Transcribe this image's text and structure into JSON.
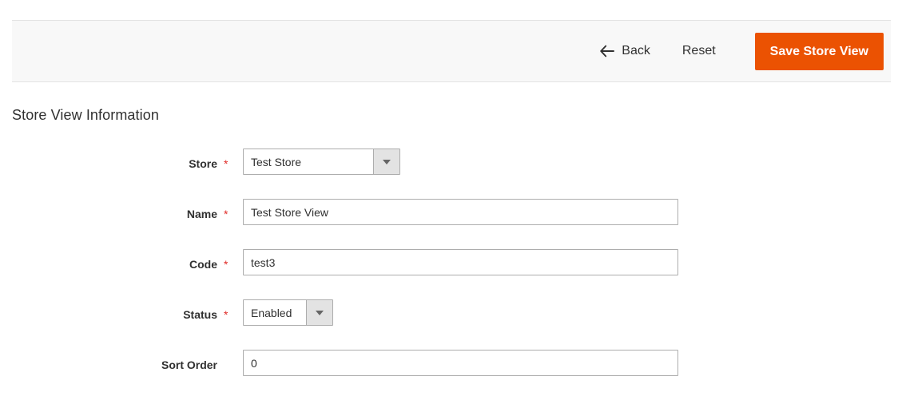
{
  "page_actions": {
    "back_label": "Back",
    "back_icon": "arrow-left-icon",
    "reset_label": "Reset",
    "save_label": "Save Store View",
    "save_color": "#eb5202",
    "bar_background": "#f8f8f8"
  },
  "section": {
    "title": "Store View Information"
  },
  "required_marker": "*",
  "required_marker_color": "#e02b27",
  "fields": [
    {
      "name": "store",
      "label": "Store",
      "required": true,
      "type": "select",
      "value": "Test Store",
      "dropdown_icon": "chevron-down-icon"
    },
    {
      "name": "name",
      "label": "Name",
      "required": true,
      "type": "text",
      "value": "Test Store View",
      "placeholder": ""
    },
    {
      "name": "code",
      "label": "Code",
      "required": true,
      "type": "text",
      "value": "test3",
      "placeholder": ""
    },
    {
      "name": "status",
      "label": "Status",
      "required": true,
      "type": "select",
      "value": "Enabled",
      "dropdown_icon": "chevron-down-icon"
    },
    {
      "name": "sort_order",
      "label": "Sort Order",
      "required": false,
      "type": "text",
      "value": "0",
      "placeholder": ""
    }
  ]
}
